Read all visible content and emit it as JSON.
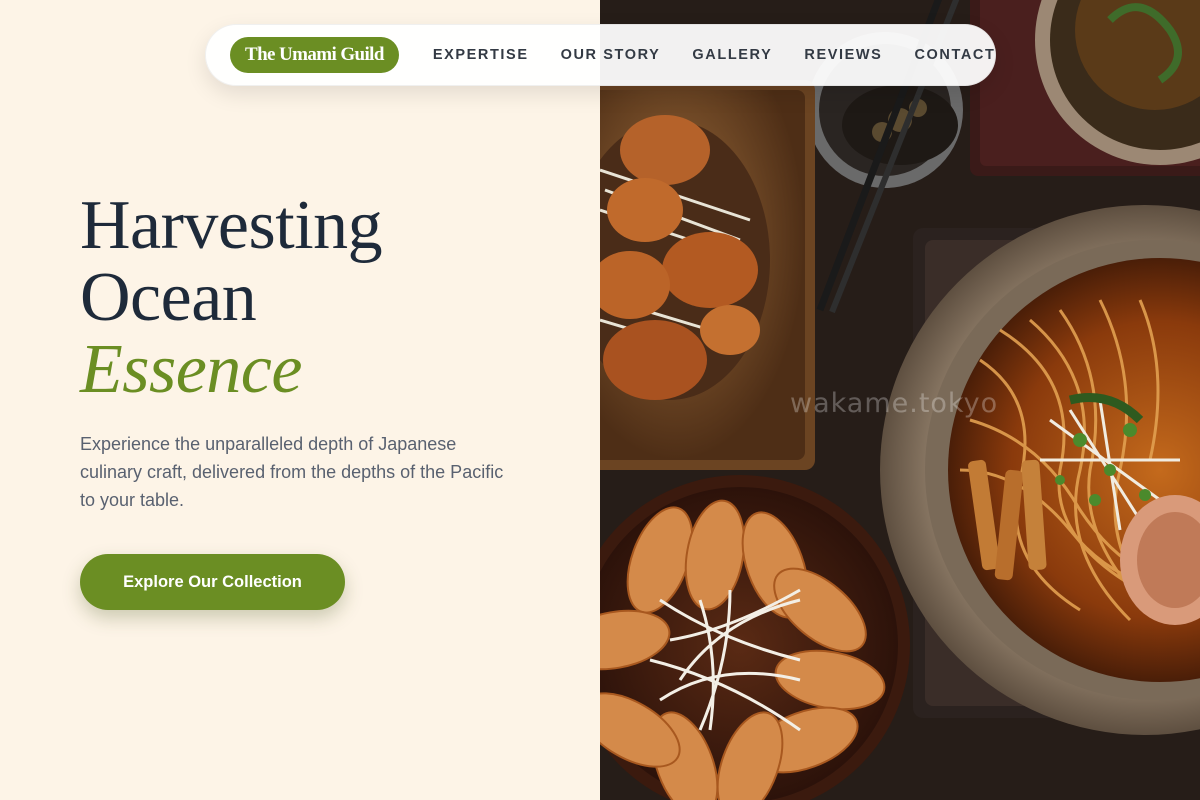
{
  "nav": {
    "logo": "The Umami Guild",
    "links": [
      "EXPERTISE",
      "OUR STORY",
      "GALLERY",
      "REVIEWS",
      "CONTACT"
    ]
  },
  "hero": {
    "title_line1": "Harvesting",
    "title_line2": "Ocean",
    "title_accent": "Essence",
    "description": "Experience the unparalleled depth of Japanese culinary craft, delivered from the depths of the Pacific to your table.",
    "cta_label": "Explore Our Collection"
  },
  "photo": {
    "watermark": "wakame.tokyo"
  },
  "colors": {
    "accent": "#6b8e23",
    "background": "#fdf4e7",
    "heading": "#1e2a3a",
    "body_text": "#596170"
  }
}
